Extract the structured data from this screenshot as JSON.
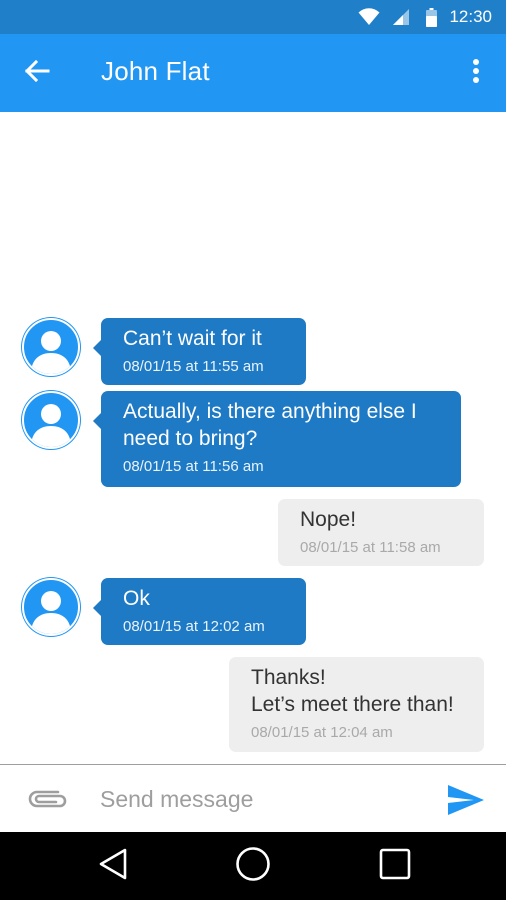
{
  "status_bar": {
    "time": "12:30",
    "icons": [
      "wifi-icon",
      "cell-signal-icon",
      "battery-icon"
    ]
  },
  "app_bar": {
    "title": "John Flat",
    "back_icon": "arrow-left-icon",
    "menu_icon": "more-vert-icon"
  },
  "messages": [
    {
      "direction": "incoming",
      "text": "Can’t wait for it",
      "timestamp": "08/01/15 at 11:55 am"
    },
    {
      "direction": "incoming",
      "text": "Actually, is there anything else I\nneed to bring?",
      "timestamp": "08/01/15 at 11:56 am"
    },
    {
      "direction": "outgoing",
      "text": "Nope!",
      "timestamp": "08/01/15 at 11:58 am"
    },
    {
      "direction": "incoming",
      "text": "Ok",
      "timestamp": "08/01/15 at 12:02 am"
    },
    {
      "direction": "outgoing",
      "text": "Thanks!\nLet’s meet there than!",
      "timestamp": "08/01/15 at 12:04 am"
    }
  ],
  "composer": {
    "placeholder": "Send message",
    "value": "",
    "attach_icon": "paperclip-icon",
    "send_icon": "send-icon"
  },
  "nav_bar": {
    "icons": [
      "back-triangle-icon",
      "home-circle-icon",
      "recents-square-icon"
    ]
  },
  "colors": {
    "status_bar": "#1f7fc8",
    "app_bar": "#2196f3",
    "incoming_bubble": "#1e7ac4",
    "outgoing_bubble": "#eeeeee",
    "accent": "#2196f3"
  }
}
